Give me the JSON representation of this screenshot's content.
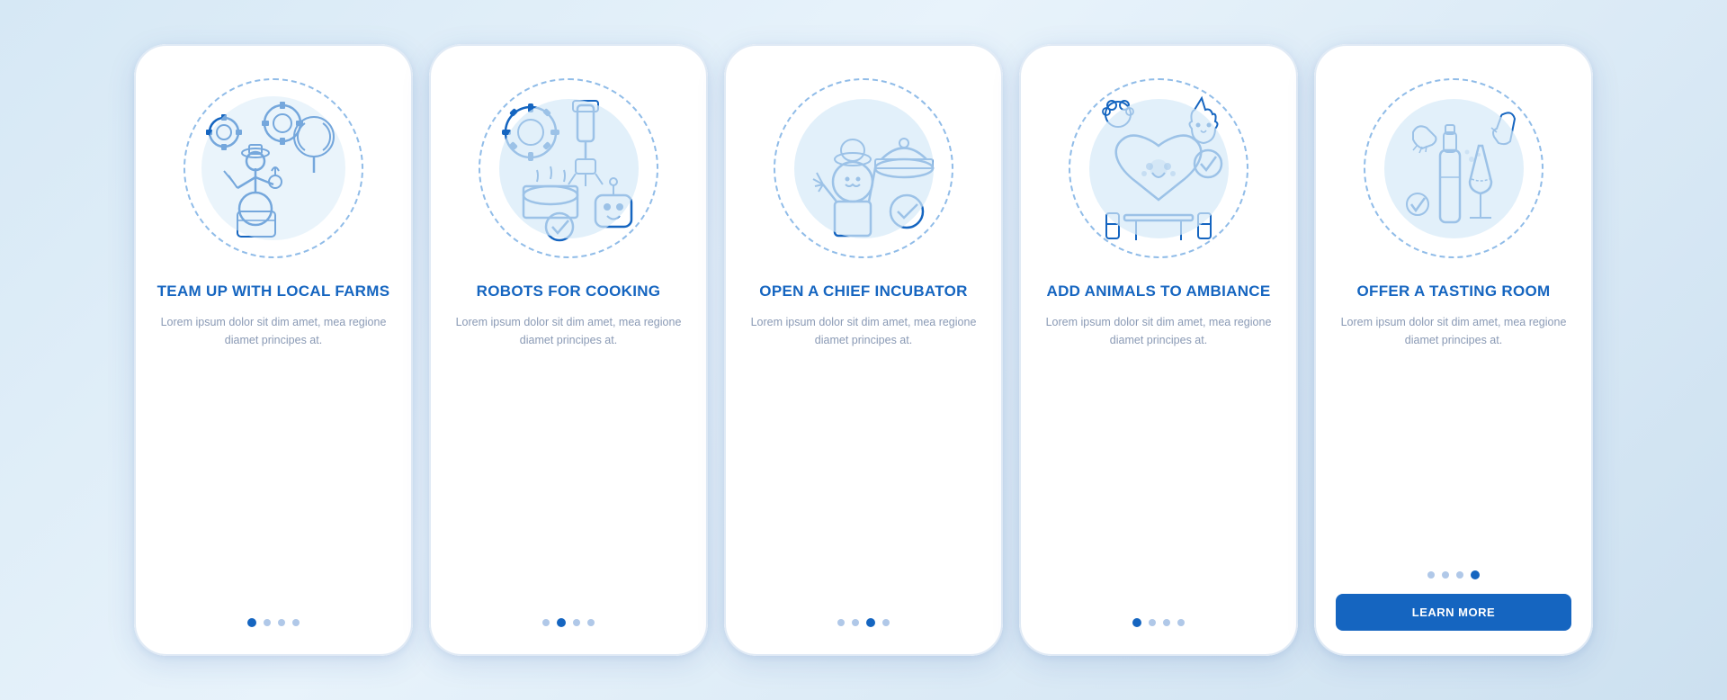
{
  "cards": [
    {
      "id": "team-up",
      "title": "TEAM UP WITH\nLOCAL FARMS",
      "description": "Lorem ipsum dolor sit dim amet, mea regione diamet principes at.",
      "dots": [
        1,
        2,
        3,
        4
      ],
      "active_dot": 1,
      "show_button": false,
      "button_label": ""
    },
    {
      "id": "robots",
      "title": "ROBOTS FOR\nCOOKING",
      "description": "Lorem ipsum dolor sit dim amet, mea regione diamet principes at.",
      "dots": [
        1,
        2,
        3,
        4
      ],
      "active_dot": 2,
      "show_button": false,
      "button_label": ""
    },
    {
      "id": "chief-incubator",
      "title": "OPEN A CHIEF\nINCUBATOR",
      "description": "Lorem ipsum dolor sit dim amet, mea regione diamet principes at.",
      "dots": [
        1,
        2,
        3,
        4
      ],
      "active_dot": 3,
      "show_button": false,
      "button_label": ""
    },
    {
      "id": "animals",
      "title": "ADD ANIMALS\nTO AMBIANCE",
      "description": "Lorem ipsum dolor sit dim amet, mea regione diamet principes at.",
      "dots": [
        1,
        2,
        3,
        4
      ],
      "active_dot": 1,
      "show_button": false,
      "button_label": ""
    },
    {
      "id": "tasting-room",
      "title": "OFFER A\nTASTING ROOM",
      "description": "Lorem ipsum dolor sit dim amet, mea regione diamet principes at.",
      "dots": [
        1,
        2,
        3,
        4
      ],
      "active_dot": 4,
      "show_button": true,
      "button_label": "LEARN MORE"
    }
  ]
}
